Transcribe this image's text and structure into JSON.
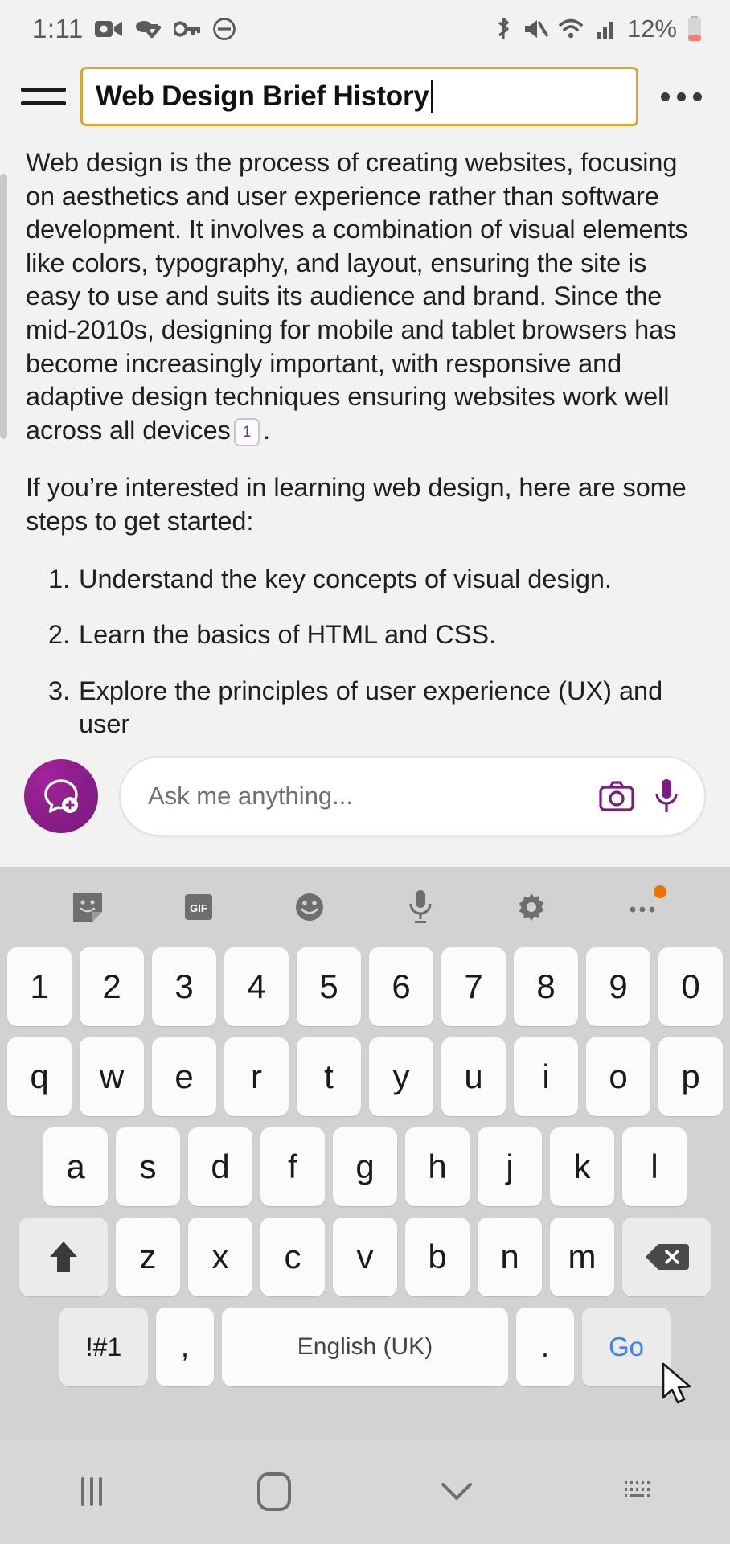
{
  "statusbar": {
    "time": "1:11",
    "battery_percent": "12%",
    "left_icons": [
      "video-recorder-icon",
      "vpn-key-check-icon",
      "key-icon",
      "do-not-disturb-icon"
    ],
    "right_icons": [
      "bluetooth-icon",
      "mute-icon",
      "wifi-icon",
      "signal-icon"
    ],
    "battery_color": "#f08070"
  },
  "titlebar": {
    "menu_icon": "hamburger-menu-icon",
    "note_title": "Web Design Brief History",
    "overflow_icon": "more-options-icon",
    "border_color": "#d8a72b"
  },
  "content": {
    "paragraph1": "Web design is the process of creating websites, focusing on aesthetics and user experience rather than software development. It involves a combination of visual elements like colors, typography, and layout, ensuring the site is easy to use and suits its audience and brand. Since the mid-2010s, designing for mobile and tablet browsers has become increasingly important, with responsive and adaptive design techniques ensuring websites work well across all devices",
    "citation_label": "1",
    "paragraph1_end": ".",
    "paragraph2": "If you’re interested in learning web design, here are some steps to get started:",
    "steps": [
      {
        "num": "1.",
        "text": "Understand the key concepts of visual design."
      },
      {
        "num": "2.",
        "text": "Learn the basics of HTML and CSS."
      },
      {
        "num": "3.",
        "text": "Explore the principles of user experience (UX) and user"
      }
    ]
  },
  "composer": {
    "new_chat_icon": "new-chat-bubble-plus-icon",
    "input_placeholder": "Ask me anything...",
    "camera_icon": "camera-icon",
    "mic_icon": "microphone-icon",
    "accent_color": "#8e1f8c"
  },
  "keyboard": {
    "toolbar": [
      {
        "name": "sticker-icon",
        "label": ""
      },
      {
        "name": "gif-icon",
        "label": "GIF"
      },
      {
        "name": "emoji-icon",
        "label": ""
      },
      {
        "name": "voice-input-icon",
        "label": ""
      },
      {
        "name": "keyboard-settings-icon",
        "label": ""
      },
      {
        "name": "keyboard-more-icon",
        "label": ""
      }
    ],
    "row_numbers": [
      "1",
      "2",
      "3",
      "4",
      "5",
      "6",
      "7",
      "8",
      "9",
      "0"
    ],
    "row_top": [
      "q",
      "w",
      "e",
      "r",
      "t",
      "y",
      "u",
      "i",
      "o",
      "p"
    ],
    "row_home": [
      "a",
      "s",
      "d",
      "f",
      "g",
      "h",
      "j",
      "k",
      "l"
    ],
    "row_bottom": [
      "z",
      "x",
      "c",
      "v",
      "b",
      "n",
      "m"
    ],
    "shift_icon": "shift-arrow-icon",
    "backspace_icon": "backspace-icon",
    "symbols_label": "!#1",
    "comma_label": ",",
    "space_label": "English (UK)",
    "period_label": ".",
    "go_label": "Go",
    "go_color": "#3b82f6"
  },
  "navbar": {
    "recents_icon": "recents-icon",
    "home_icon": "home-icon",
    "back_icon": "hide-keyboard-chevron-icon",
    "keyboard_icon": "keyboard-switch-icon"
  }
}
